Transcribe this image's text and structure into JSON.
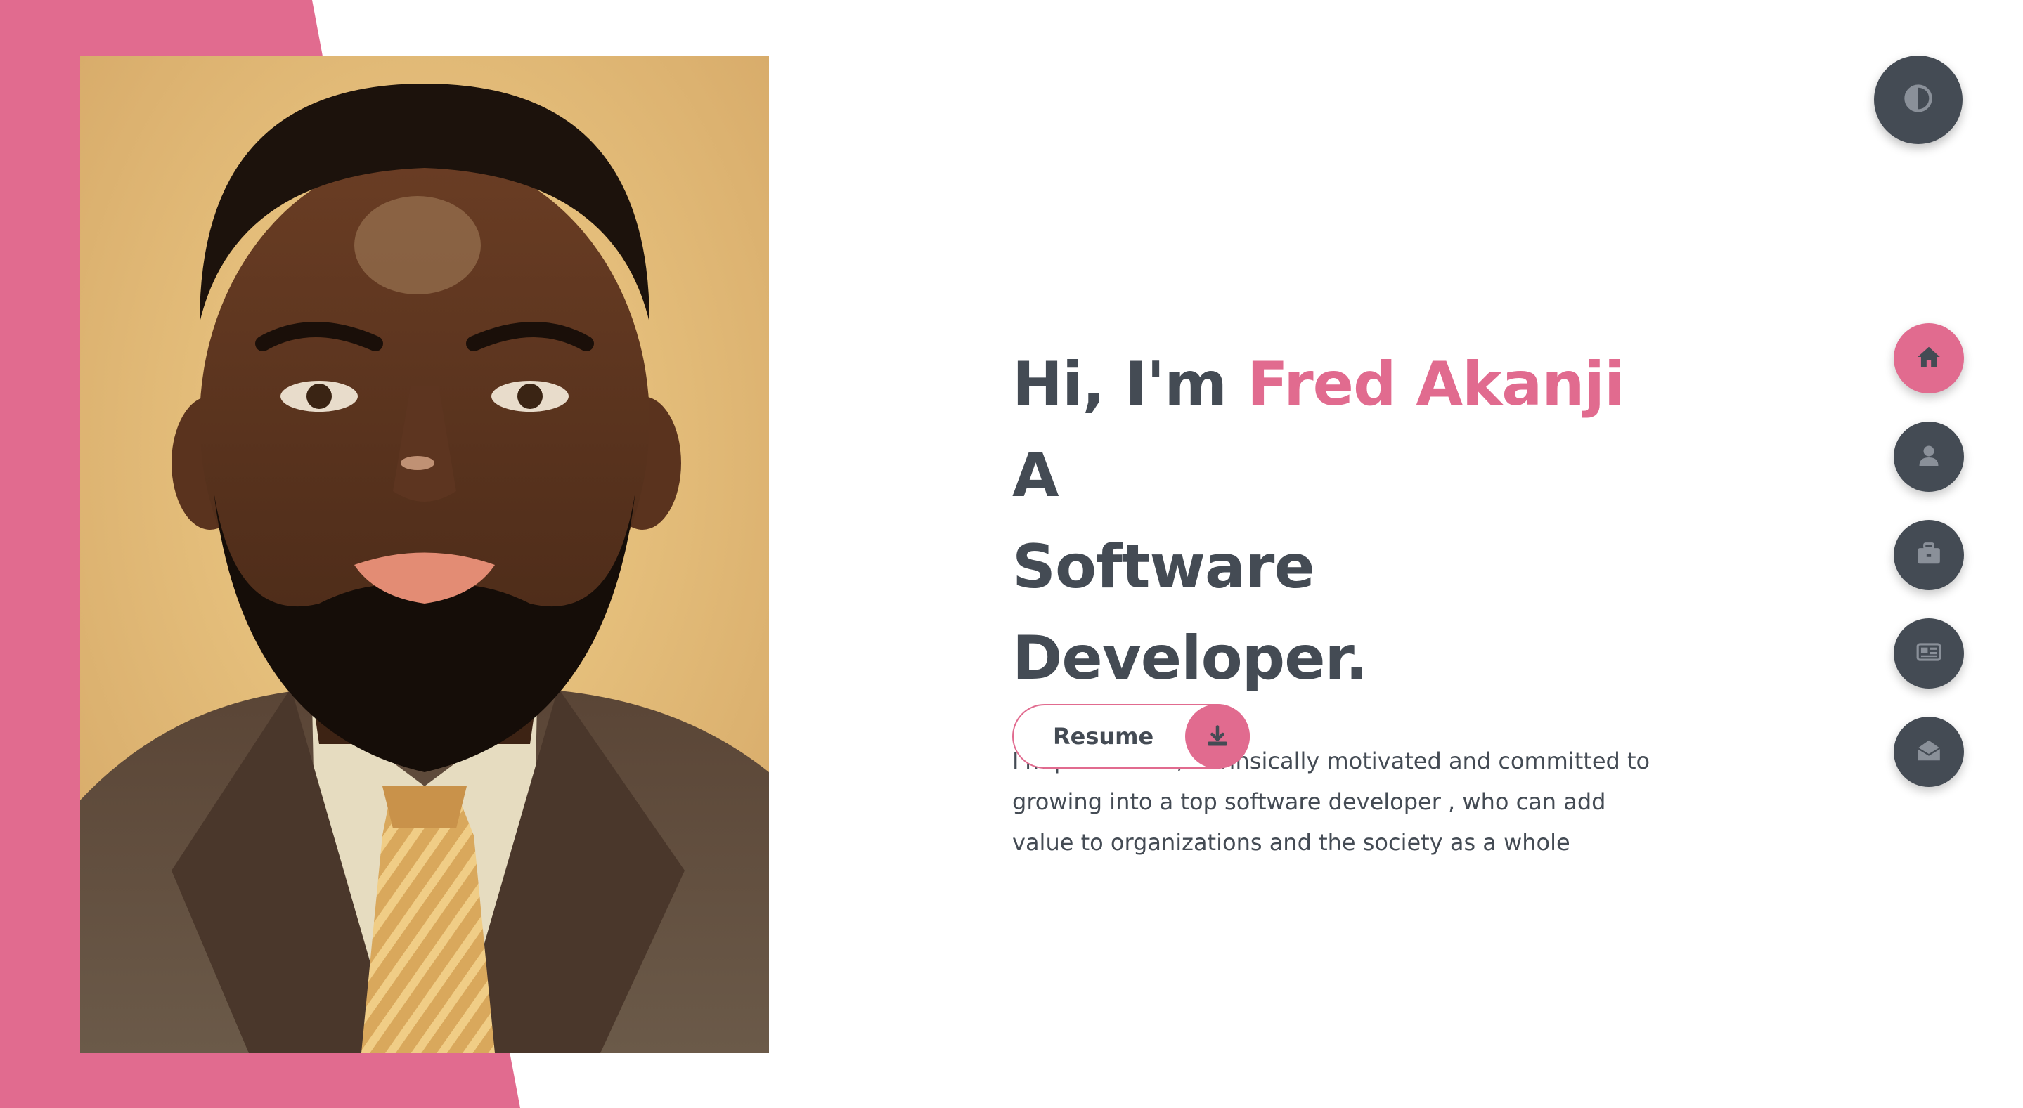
{
  "hero": {
    "greeting": "Hi, I'm",
    "name": "Fred Akanji",
    "title_line1_suffix": "A",
    "title_line2": "Software Developer.",
    "bio": "I'm passionate, intrinsically motivated and committed to growing into a top software developer , who can add value to organizations and the society as a whole"
  },
  "resume": {
    "label": "Resume",
    "icon": "download-icon"
  },
  "theme_toggle": {
    "icon": "contrast-icon"
  },
  "nav": {
    "items": [
      {
        "key": "home",
        "icon": "home-icon",
        "active": true
      },
      {
        "key": "about",
        "icon": "user-icon",
        "active": false
      },
      {
        "key": "portfolio",
        "icon": "briefcase-icon",
        "active": false
      },
      {
        "key": "blog",
        "icon": "news-icon",
        "active": false
      },
      {
        "key": "contact",
        "icon": "envelope-open-icon",
        "active": false
      }
    ]
  },
  "colors": {
    "accent": "#e16b8f",
    "dark": "#444b54",
    "background": "#ffffff"
  }
}
